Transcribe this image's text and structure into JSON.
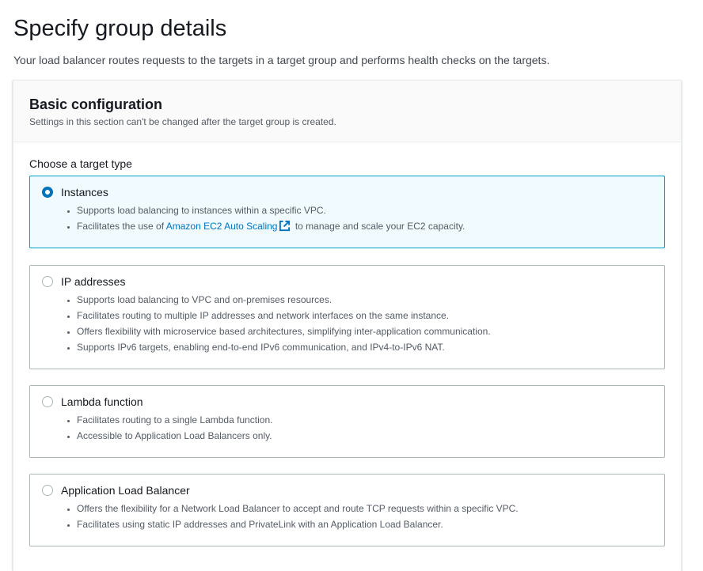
{
  "page": {
    "title": "Specify group details",
    "description": "Your load balancer routes requests to the targets in a target group and performs health checks on the targets."
  },
  "basic_configuration": {
    "title": "Basic configuration",
    "description": "Settings in this section can't be changed after the target group is created.",
    "target_type_label": "Choose a target type",
    "selected": "Instances",
    "options": [
      {
        "label": "Instances",
        "bullets": [
          "Supports load balancing to instances within a specific VPC.",
          {
            "before": "Facilitates the use of ",
            "link": "Amazon EC2 Auto Scaling",
            "after": " to manage and scale your EC2 capacity."
          }
        ]
      },
      {
        "label": "IP addresses",
        "bullets": [
          "Supports load balancing to VPC and on-premises resources.",
          "Facilitates routing to multiple IP addresses and network interfaces on the same instance.",
          "Offers flexibility with microservice based architectures, simplifying inter-application communication.",
          "Supports IPv6 targets, enabling end-to-end IPv6 communication, and IPv4-to-IPv6 NAT."
        ]
      },
      {
        "label": "Lambda function",
        "bullets": [
          "Facilitates routing to a single Lambda function.",
          "Accessible to Application Load Balancers only."
        ]
      },
      {
        "label": "Application Load Balancer",
        "bullets": [
          "Offers the flexibility for a Network Load Balancer to accept and route TCP requests within a specific VPC.",
          "Facilitates using static IP addresses and PrivateLink with an Application Load Balancer."
        ]
      }
    ]
  },
  "icons": {
    "external_link": "external-link-icon"
  },
  "colors": {
    "accent": "#0073bb",
    "selected_border": "#00a1c9",
    "selected_bg": "#f1faff"
  }
}
